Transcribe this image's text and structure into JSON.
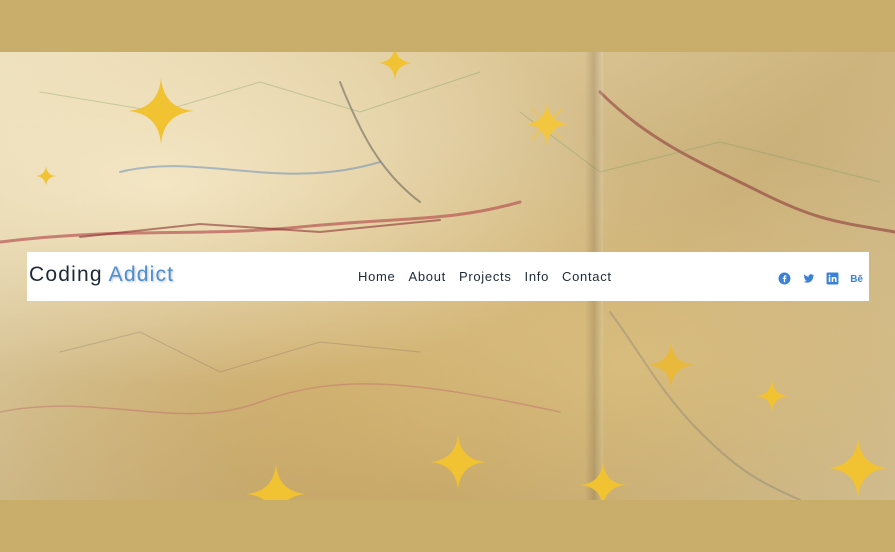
{
  "brand": {
    "first": "Coding",
    "second": "Addict"
  },
  "nav": {
    "links": [
      "Home",
      "About",
      "Projects",
      "Info",
      "Contact"
    ]
  },
  "social": {
    "icons": [
      "facebook-icon",
      "twitter-icon",
      "linkedin-icon",
      "behance-icon"
    ],
    "behance_label": "Bē",
    "icon_color": "#3b82d6"
  },
  "hero": {
    "background": "road-map-image",
    "overlay": "gold-sparkles"
  },
  "colors": {
    "frame": "#c9ad6a",
    "navbar": "#ffffff",
    "text": "#1f2a36",
    "accent": "#4c8fd4",
    "sparkle": "#f1c232"
  }
}
